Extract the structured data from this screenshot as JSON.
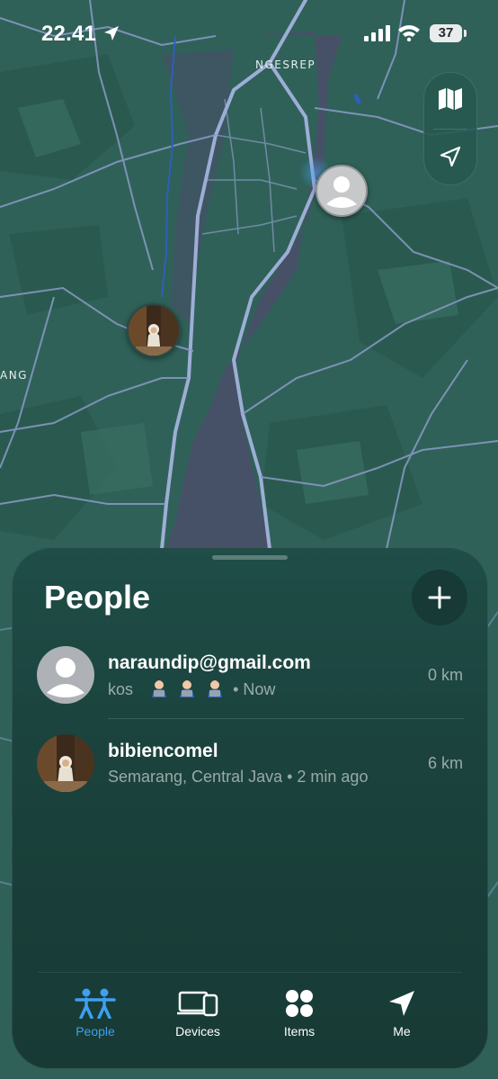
{
  "status_bar": {
    "time": "22.41",
    "battery": "37"
  },
  "map": {
    "labels": [
      "NGESREP",
      "ANG"
    ]
  },
  "sheet": {
    "title": "People",
    "people": [
      {
        "name": "naraundip@gmail.com",
        "subtitle_prefix": "kos",
        "subtitle_suffix": "• Now",
        "distance": "0 km",
        "avatar": "default-avatar"
      },
      {
        "name": "bibiencomel",
        "subtitle": "Semarang, Central Java • 2 min ago",
        "distance": "6 km",
        "avatar": "photo-avatar"
      }
    ]
  },
  "tabs": [
    {
      "label": "People",
      "icon": "people-icon",
      "active": true
    },
    {
      "label": "Devices",
      "icon": "devices-icon",
      "active": false
    },
    {
      "label": "Items",
      "icon": "items-icon",
      "active": false
    },
    {
      "label": "Me",
      "icon": "location-arrow-icon",
      "active": false
    }
  ],
  "colors": {
    "accent": "#3ea0f0",
    "map_land": "#2e5f58",
    "sheet": "#1b423d"
  }
}
